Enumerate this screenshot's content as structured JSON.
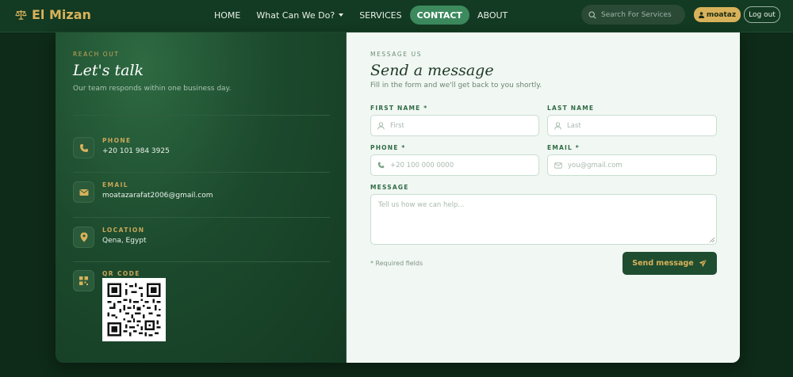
{
  "brand": {
    "name": "El Mizan",
    "icon": "scales-icon"
  },
  "nav": {
    "items": [
      {
        "label": "HOME",
        "active": false
      },
      {
        "label": "What Can We Do?",
        "active": false,
        "dropdown": true
      },
      {
        "label": "SERVICES",
        "active": false
      },
      {
        "label": "CONTACT",
        "active": true
      },
      {
        "label": "ABOUT",
        "active": false
      }
    ],
    "search_placeholder": "Search For Services",
    "user_label": "moataz",
    "logout_label": "Log out"
  },
  "contact_info": {
    "eyebrow": "REACH OUT",
    "title": "Let's talk",
    "subtitle": "Our team responds within one business day.",
    "items": [
      {
        "label": "PHONE",
        "value": "+20 101 984 3925",
        "icon": "phone-icon"
      },
      {
        "label": "EMAIL",
        "value": "moatazarafat2006@gmail.com",
        "icon": "mail-icon"
      },
      {
        "label": "LOCATION",
        "value": "Qena, Egypt",
        "icon": "location-pin-icon"
      },
      {
        "label": "QR CODE",
        "value": "",
        "icon": "qr-icon"
      }
    ]
  },
  "form": {
    "eyebrow": "MESSAGE US",
    "title": "Send a message",
    "subtitle": "Fill in the form and we'll get back to you shortly.",
    "first_name_label": "FIRST NAME *",
    "first_name_placeholder": "First",
    "last_name_label": "LAST NAME",
    "last_name_placeholder": "Last",
    "phone_label": "PHONE *",
    "phone_placeholder": "+20 100 000 0000",
    "email_label": "EMAIL *",
    "email_placeholder": "you@gmail.com",
    "message_label": "MESSAGE",
    "message_placeholder": "Tell us how we can help...",
    "required_note": "* Required fields",
    "submit_label": "Send message"
  },
  "colors": {
    "gold": "#d8b25a",
    "dark_green": "#153a23",
    "active_nav": "#3c8a5e",
    "form_bg": "#f1f7f2"
  }
}
